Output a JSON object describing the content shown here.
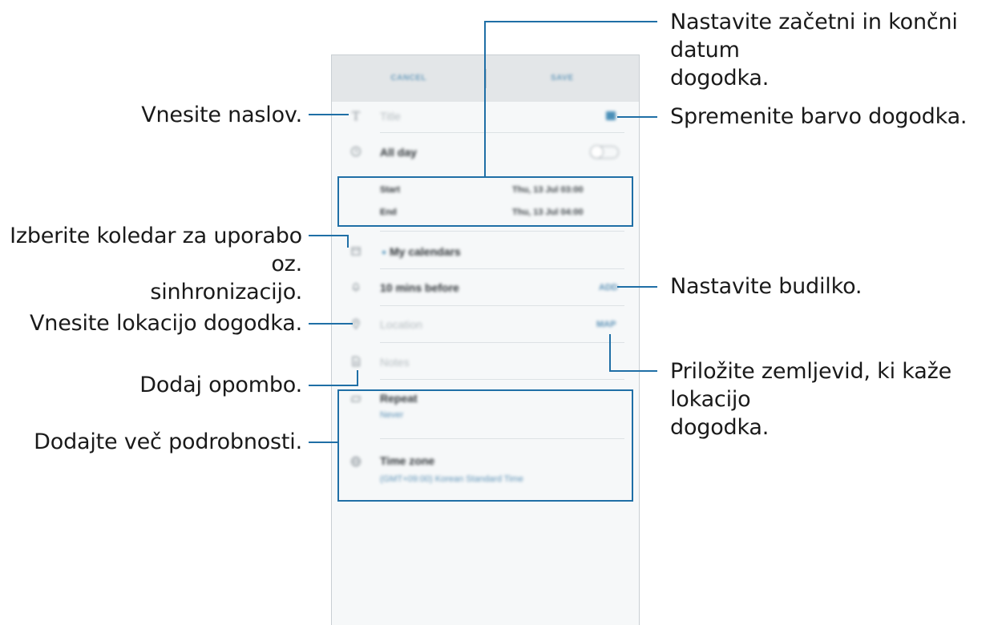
{
  "callouts": {
    "date_range": [
      "Nastavite začetni in končni datum",
      "dogodka."
    ],
    "title": "Vnesite naslov.",
    "color": "Spremenite barvo dogodka.",
    "calendar": [
      "Izberite koledar za uporabo oz.",
      "sinhronizacijo."
    ],
    "alarm": "Nastavite budilko.",
    "location": "Vnesite lokacijo dogodka.",
    "map": [
      "Priložite zemljevid, ki kaže lokacijo",
      "dogodka."
    ],
    "note": "Dodaj opombo.",
    "more": "Dodajte več podrobnosti."
  },
  "app": {
    "cancel": "CANCEL",
    "save": "SAVE",
    "title_placeholder": "Title",
    "all_day": "All day",
    "all_day_on": false,
    "start_label": "Start",
    "start_value": "Thu, 13 Jul   03:00",
    "end_label": "End",
    "end_value": "Thu, 13 Jul   04:00",
    "calendar": "My calendars",
    "reminder": "10 mins before",
    "reminder_action": "ADD",
    "location_placeholder": "Location",
    "map_action": "MAP",
    "notes_placeholder": "Notes",
    "repeat_label": "Repeat",
    "repeat_value": "Never",
    "timezone_label": "Time zone",
    "timezone_value": "(GMT+09:00) Korean Standard Time",
    "accent": "#1f6fa6",
    "event_color": "#4a8fb8"
  }
}
